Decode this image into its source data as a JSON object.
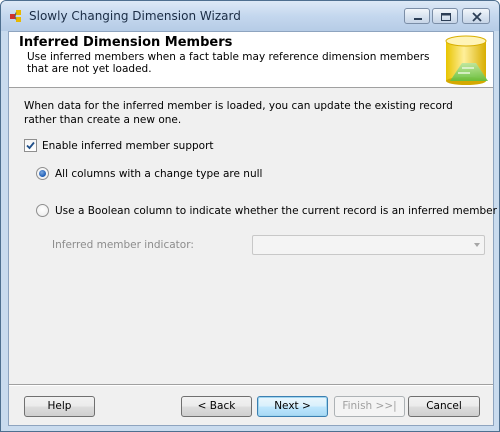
{
  "window": {
    "title": "Slowly Changing Dimension Wizard",
    "app_icon": "ssis-wizard-icon"
  },
  "header": {
    "title": "Inferred Dimension Members",
    "description": "Use inferred members when a fact table may reference dimension members that are not yet loaded.",
    "graphic": "database-cylinder-icon"
  },
  "body": {
    "intro": "When data for the inferred member is loaded, you can update the existing record rather than create a new one.",
    "enable_checkbox": {
      "label": "Enable inferred member support",
      "checked": true
    },
    "options": [
      {
        "label": "All columns with a change type are null",
        "selected": true
      },
      {
        "label": "Use a Boolean column to indicate whether the current record is an inferred member",
        "selected": false
      }
    ],
    "indicator": {
      "label": "Inferred member indicator:",
      "value": "",
      "enabled": false
    }
  },
  "buttons": {
    "help": "Help",
    "back": "< Back",
    "next": "Next >",
    "finish": "Finish >>|",
    "cancel": "Cancel"
  },
  "colors": {
    "accent_radio": "#1c5cb5",
    "disabled_text": "#8c8c8c",
    "title_bar": "#c4d7ee"
  }
}
